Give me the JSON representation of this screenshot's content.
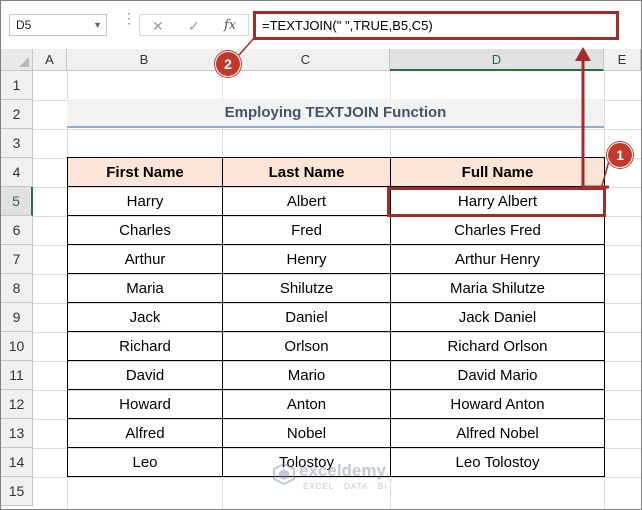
{
  "name_box": {
    "value": "D5"
  },
  "formula_bar": {
    "cancel_glyph": "✕",
    "enter_glyph": "✓",
    "fx_glyph": "fx",
    "formula": "=TEXTJOIN(\" \",TRUE,B5,C5)"
  },
  "columns": [
    "A",
    "B",
    "C",
    "D",
    "E"
  ],
  "selected_column": "D",
  "rows": [
    "1",
    "2",
    "3",
    "4",
    "5",
    "6",
    "7",
    "8",
    "9",
    "10",
    "11",
    "12",
    "13",
    "14",
    "15"
  ],
  "selected_row": "5",
  "title": "Employing TEXTJOIN Function",
  "table": {
    "headers": [
      "First Name",
      "Last Name",
      "Full Name"
    ],
    "rows": [
      [
        "Harry",
        "Albert",
        "Harry Albert"
      ],
      [
        "Charles",
        "Fred",
        "Charles Fred"
      ],
      [
        "Arthur",
        "Henry",
        "Arthur Henry"
      ],
      [
        "Maria",
        "Shilutze",
        "Maria Shilutze"
      ],
      [
        "Jack",
        "Daniel",
        "Jack Daniel"
      ],
      [
        "Richard",
        "Orlson",
        "Richard Orlson"
      ],
      [
        "David",
        "Mario",
        "David Mario"
      ],
      [
        "Howard",
        "Anton",
        "Howard Anton"
      ],
      [
        "Alfred",
        "Nobel",
        "Alfred Nobel"
      ],
      [
        "Leo",
        "Tolostoy",
        "Leo Tolostoy"
      ]
    ]
  },
  "annotations": {
    "badge_1": "1",
    "badge_2": "2",
    "accent_color": "#a52a2a"
  },
  "watermark": {
    "name": "exceldemy",
    "tagline": "EXCEL · DATA · BI"
  },
  "colors": {
    "header_fill": "#fce4d6",
    "title_text": "#44546a",
    "selection_green": "#217346"
  }
}
